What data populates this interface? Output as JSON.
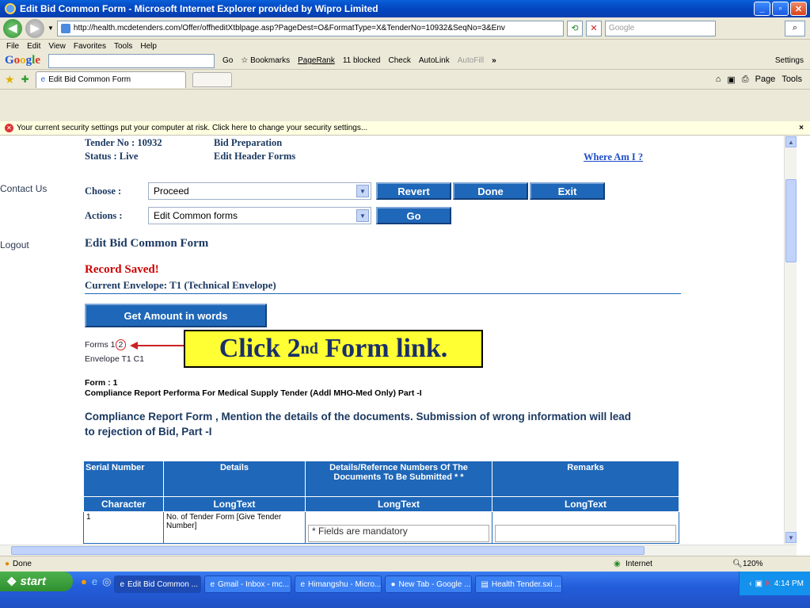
{
  "window": {
    "title": "Edit Bid Common Form - Microsoft Internet Explorer provided by Wipro Limited",
    "buttons": {
      "minimize": "_",
      "maximize": "▫",
      "close": "✕"
    }
  },
  "address": {
    "url": "http://health.mcdetenders.com/Offer/offheditXtblpage.asp?PageDest=O&FormatType=X&TenderNo=10932&SeqNo=3&Env",
    "search_placeholder": "Google"
  },
  "menu": {
    "items": [
      "File",
      "Edit",
      "View",
      "Favorites",
      "Tools",
      "Help"
    ]
  },
  "google_toolbar": {
    "logo": "Google",
    "go": "Go",
    "bookmarks": "Bookmarks",
    "pagerank": "PageRank",
    "blocked": "11 blocked",
    "check": "Check",
    "autolink": "AutoLink",
    "autofill": "AutoFill",
    "more": "»",
    "settings": "Settings"
  },
  "tabs": {
    "active": "Edit Bid Common Form",
    "page": "Page",
    "tools": "Tools"
  },
  "security_bar": {
    "text": "Your current security settings put your computer at risk. Click here to change your security settings...",
    "close": "×"
  },
  "left_nav": {
    "contact": "Contact Us",
    "logout": "Logout"
  },
  "page": {
    "tender_no": "Tender No : 10932",
    "status": "Status : Live",
    "bid_prep": "Bid Preparation",
    "edit_header_forms": "Edit Header Forms",
    "where_am_i": "Where Am I ?",
    "choose_label": "Choose :",
    "choose_value": "Proceed",
    "revert": "Revert",
    "done": "Done",
    "exit": "Exit",
    "actions_label": "Actions :",
    "actions_value": "Edit Common forms",
    "go": "Go",
    "heading": "Edit Bid Common Form",
    "record_saved": "Record Saved!",
    "current_envelope": "Current Envelope: T1 (Technical Envelope)",
    "get_amount": "Get Amount in words",
    "forms_label": "Forms 1",
    "form_link_2": "2",
    "envelope_line": "Envelope T1 C1",
    "callout": "Click 2",
    "callout_sup": "nd",
    "callout_rest": " Form link.",
    "form_no": "Form : 1",
    "form_title": "Compliance Report Performa For Medical Supply Tender (Addl MHO-Med Only) Part -I",
    "compliance_heading": "Compliance Report Form , Mention the details of the documents. Submission of wrong information will lead to rejection of Bid, Part -I"
  },
  "table": {
    "headers": [
      "Serial Number",
      "Details",
      "Details/Refernce Numbers Of The Documents To Be Submitted * *",
      "Remarks"
    ],
    "types": [
      "Character",
      "LongText",
      "LongText",
      "LongText"
    ],
    "row1": {
      "serial": "1",
      "details": "No. of Tender Form [Give Tender Number]",
      "note": "* Fields are mandatory"
    }
  },
  "status_bar": {
    "done": "Done",
    "zone": "Internet",
    "zoom": "120%"
  },
  "taskbar": {
    "start": "start",
    "items": [
      "Edit Bid Common ...",
      "Gmail - Inbox - mc...",
      "Himangshu - Micro...",
      "New Tab - Google ...",
      "Health Tender.sxi ..."
    ],
    "clock": "4:14 PM"
  }
}
